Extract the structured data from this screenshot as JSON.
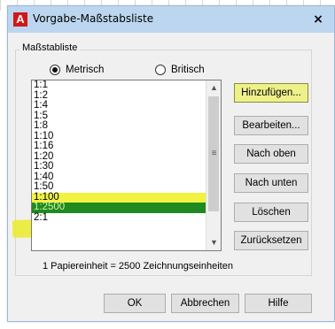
{
  "dialog": {
    "title": "Vorgabe-Maßstabsliste",
    "app_icon": "A",
    "close": "×"
  },
  "group": {
    "label": "Maßstabliste",
    "radio_metric": "Metrisch",
    "radio_imperial": "Britisch",
    "selected_unit": "Metrisch"
  },
  "list": {
    "items": [
      "1:1",
      "1:2",
      "1:4",
      "1:5",
      "1:8",
      "1:10",
      "1:16",
      "1:20",
      "1:30",
      "1:40",
      "1:50",
      "1:100",
      "1:2500",
      "2:1"
    ],
    "selected_index": 12,
    "highlighted_index": 11
  },
  "buttons": {
    "add": "Hinzufügen...",
    "edit": "Bearbeiten...",
    "up": "Nach oben",
    "down": "Nach unten",
    "delete": "Löschen",
    "reset": "Zurücksetzen",
    "ok": "OK",
    "cancel": "Abbrechen",
    "help": "Hilfe"
  },
  "status": "1 Papiereinheit = 2500 Zeichnungseinheiten",
  "colors": {
    "highlight_yellow": "#f2f240",
    "selection_green": "#1f8a1f",
    "titlebar": "#bcd6ef"
  }
}
